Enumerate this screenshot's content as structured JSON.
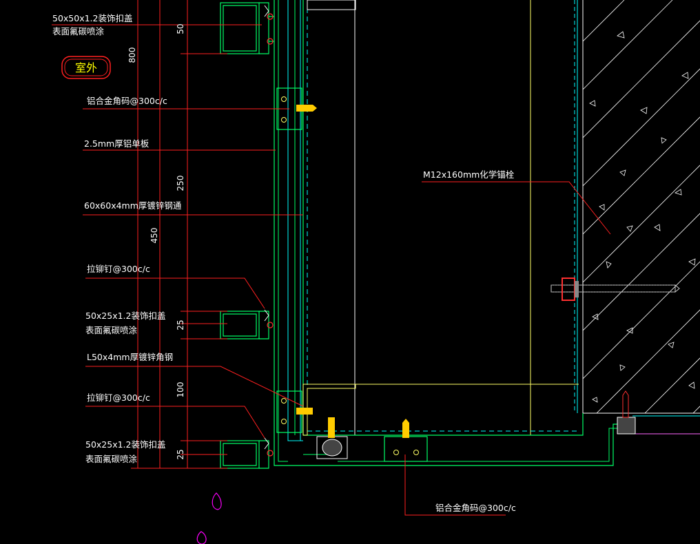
{
  "room_tag": "室外",
  "labels": {
    "cover_top_1": "50x50x1.2装饰扣盖",
    "cover_top_2": "表面氟碳喷涂",
    "angle_code_top": "铝合金角码@300c/c",
    "panel": "2.5mm厚铝单板",
    "tube": "60x60x4mm厚镀锌钢通",
    "rivet_1": "拉铆钉@300c/c",
    "cover_mid_1": "50x25x1.2装饰扣盖",
    "cover_mid_2": "表面氟碳喷涂",
    "angle_steel": "L50x4mm厚镀锌角钢",
    "rivet_2": "拉铆钉@300c/c",
    "cover_bot_1": "50x25x1.2装饰扣盖",
    "cover_bot_2": "表面氟碳喷涂",
    "anchor": "M12x160mm化学锚栓",
    "angle_code_bottom": "铝合金角码@300c/c"
  },
  "dimensions": {
    "d800": "800",
    "d450": "450",
    "d50": "50",
    "d250": "250",
    "d25a": "25",
    "d100": "100",
    "d25b": "25"
  },
  "colors": {
    "background": "#000000",
    "frame_green": "#00ff66",
    "structure_cyan": "#00ffff",
    "steel_yellow": "#ffff66",
    "leader_red": "#ff2020",
    "dimension_red": "#ff2020",
    "text_white": "#ffffff",
    "tag_red": "#ff2020",
    "tag_text": "#ffff00",
    "hatch_white": "#ffffff",
    "bolt_gray": "#cccccc",
    "magenta_mark": "#ff00ff"
  }
}
